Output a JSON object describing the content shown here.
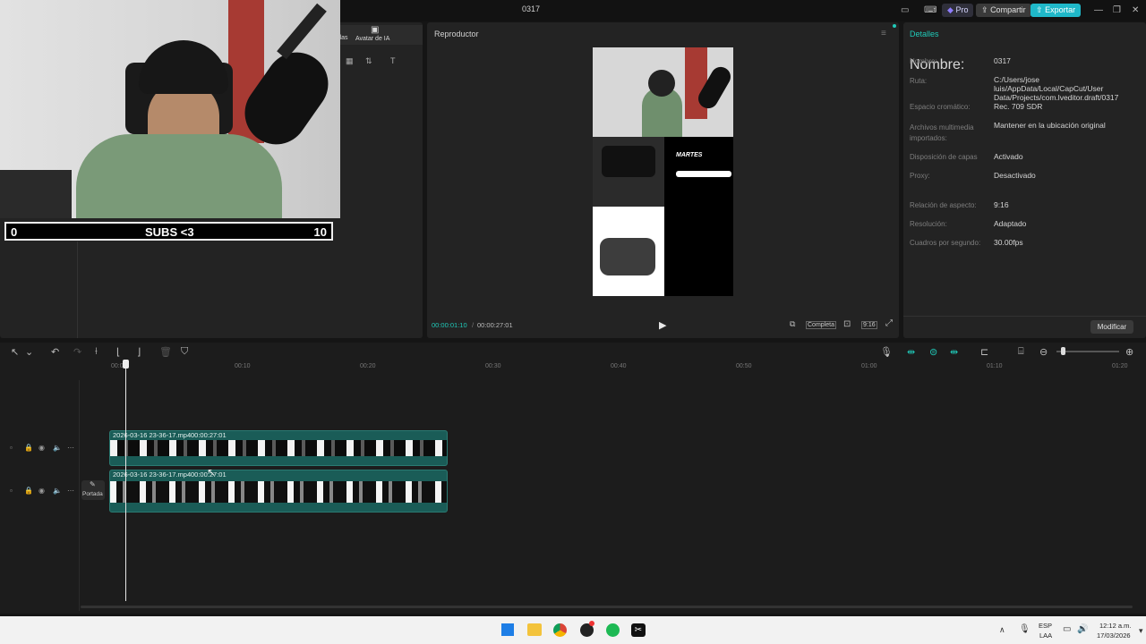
{
  "window": {
    "title": "0317"
  },
  "header": {
    "pro_label": "Pro",
    "share_label": "Compartir",
    "export_label": "Exportar"
  },
  "left_panel": {
    "tab_partial": "llas",
    "tab_avatar": "Avatar de IA"
  },
  "overlay": {
    "score_left": "0",
    "score_center": "SUBS <3",
    "score_right": "10"
  },
  "player": {
    "title": "Reproductor",
    "current_time": "00:00:01:10",
    "total_time": "00:00:27:01",
    "complete_label": "Completa",
    "ratio_label": "9:16",
    "preview": {
      "day": "MARTES"
    }
  },
  "details": {
    "title": "Detalles",
    "rows": [
      {
        "label": "Nombre:",
        "value": "0317"
      },
      {
        "label": "Ruta:",
        "value": "C:/Users/jose luis/AppData/Local/CapCut/User Data/Projects/com.lveditor.draft/0317"
      },
      {
        "label": "Espacio cromático:",
        "value": "Rec. 709 SDR"
      },
      {
        "label": "Archivos multimedia importados:",
        "value": "Mantener en la ubicación original"
      },
      {
        "label": "Disposición de capas",
        "value": "Activado"
      },
      {
        "label": "Proxy:",
        "value": "Desactivado"
      },
      {
        "label": "Relación de aspecto:",
        "value": "9:16"
      },
      {
        "label": "Resolución:",
        "value": "Adaptado"
      },
      {
        "label": "Cuadros por segundo:",
        "value": "30.00fps"
      }
    ],
    "modify_label": "Modificar"
  },
  "timeline": {
    "ruler": [
      "00:00",
      "00:10",
      "00:20",
      "00:30",
      "00:40",
      "00:50",
      "01:00",
      "01:10",
      "01:20"
    ],
    "clip1": {
      "name": "2026-03-16 23-36-17.mp4",
      "duration": "00:00:27:01"
    },
    "clip2": {
      "name": "2026-03-16 23-36-17.mp4",
      "duration": "00:00:27:01"
    },
    "cover_label": "Portada"
  },
  "taskbar": {
    "lang": "ESP",
    "layout": "LAA",
    "time": "12:12 a.m.",
    "date": "17/03/2026"
  },
  "colors": {
    "accent": "#20c9b8",
    "export": "#1fb8c9",
    "clip": "#1a5c57"
  }
}
